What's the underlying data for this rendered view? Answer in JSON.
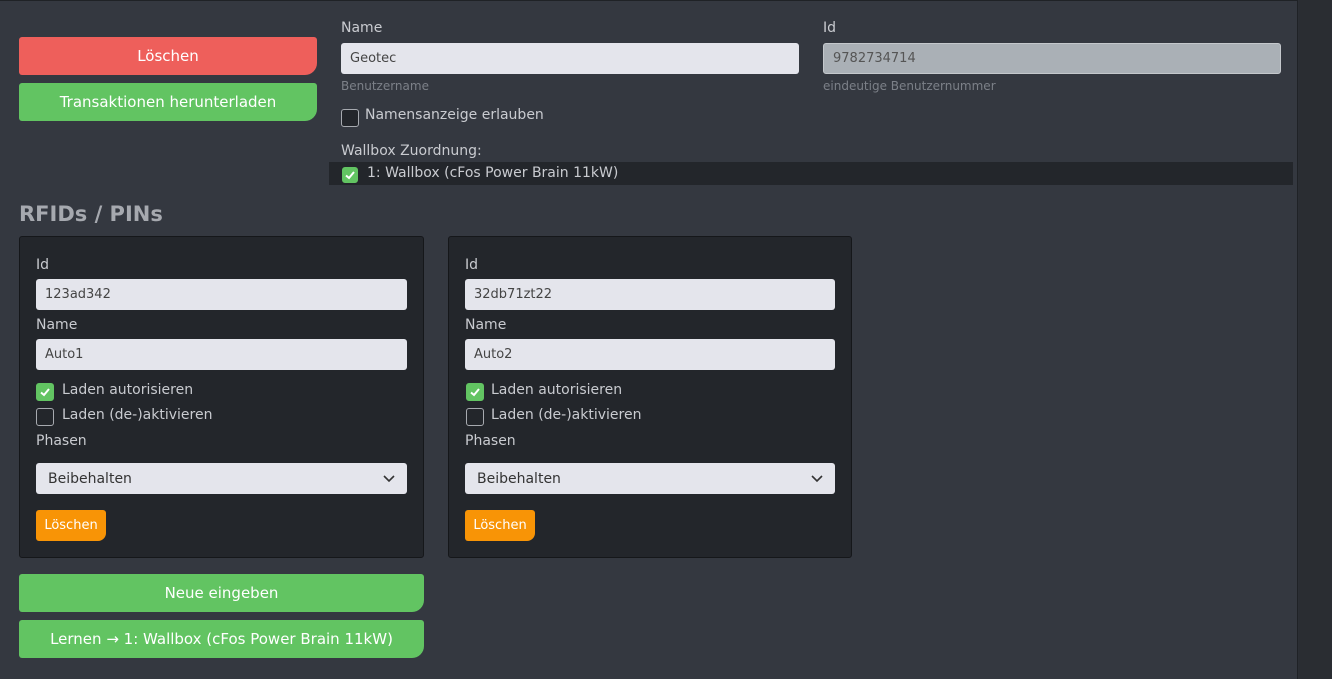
{
  "actions": {
    "delete_label": "Löschen",
    "download_label": "Transaktionen herunterladen"
  },
  "user": {
    "name_label": "Name",
    "name_value": "Geotec",
    "name_help": "Benutzername",
    "id_label": "Id",
    "id_value": "9782734714",
    "id_help": "eindeutige Benutzernummer",
    "allow_name_label": "Namensanzeige erlauben",
    "allow_name_checked": false,
    "wallbox_label": "Wallbox Zuordnung:",
    "wallbox_item": "1: Wallbox (cFos Power Brain 11kW)",
    "wallbox_checked": true
  },
  "rfids": {
    "title": "RFIDs / PINs",
    "cards": [
      {
        "id_label": "Id",
        "id_value": "123ad342",
        "name_label": "Name",
        "name_value": "Auto1",
        "authorize_label": "Laden autorisieren",
        "authorize_checked": true,
        "toggle_label": "Laden (de-)aktivieren",
        "toggle_checked": false,
        "phases_label": "Phasen",
        "phases_value": "Beibehalten",
        "delete_label": "Löschen"
      },
      {
        "id_label": "Id",
        "id_value": "32db71zt22",
        "name_label": "Name",
        "name_value": "Auto2",
        "authorize_label": "Laden autorisieren",
        "authorize_checked": true,
        "toggle_label": "Laden (de-)aktivieren",
        "toggle_checked": false,
        "phases_label": "Phasen",
        "phases_value": "Beibehalten",
        "delete_label": "Löschen"
      }
    ],
    "new_label": "Neue eingeben",
    "learn_label": "Lernen → 1: Wallbox (cFos Power Brain 11kW)"
  },
  "colors": {
    "red": "#ee5f5b",
    "green": "#62c462",
    "orange": "#f89406"
  }
}
